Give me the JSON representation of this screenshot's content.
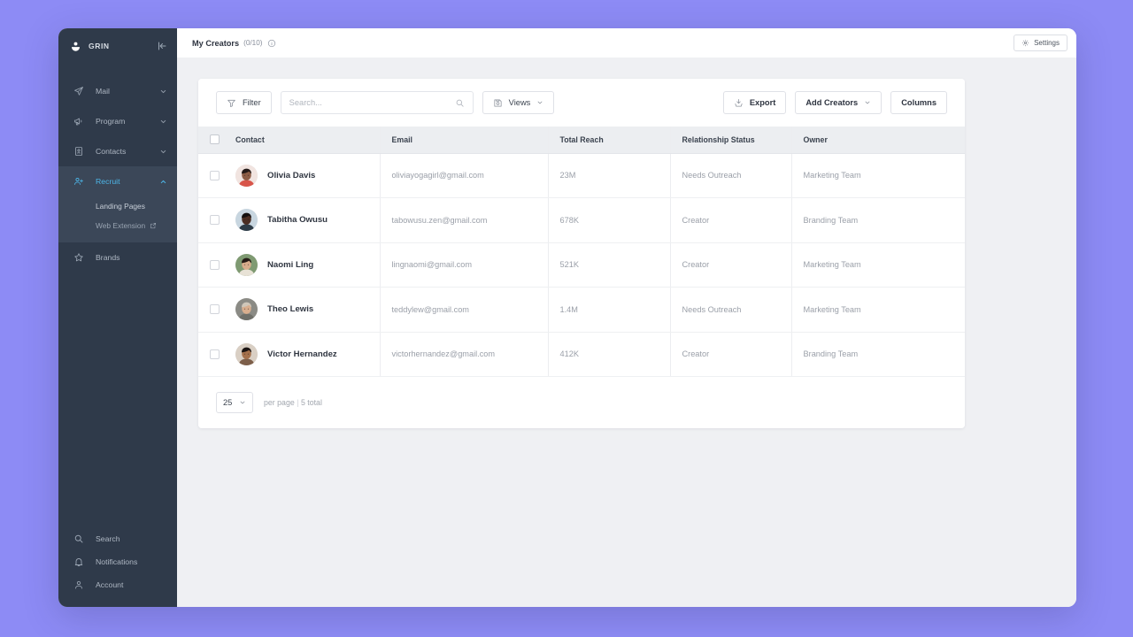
{
  "theme": {
    "desktop_bg": "#8d8bf5",
    "sidebar_bg": "#2f3a4a",
    "sidebar_active_bg": "#3b4758",
    "accent": "#4db6e8",
    "content_bg": "#eff0f3",
    "card_bg": "#ffffff",
    "table_header_bg": "#eceef1"
  },
  "sidebar": {
    "brand": {
      "name": "GRIN",
      "logo_icon": "grin-logo-icon",
      "collapse_icon": "collapse-panel-icon"
    },
    "items": [
      {
        "label": "Mail",
        "icon": "paper-plane-icon",
        "chevron": "chevron-down-icon",
        "active": false
      },
      {
        "label": "Program",
        "icon": "megaphone-icon",
        "chevron": "chevron-down-icon",
        "active": false
      },
      {
        "label": "Contacts",
        "icon": "contact-card-icon",
        "chevron": "chevron-down-icon",
        "active": false
      },
      {
        "label": "Recruit",
        "icon": "user-plus-icon",
        "chevron": "chevron-up-icon",
        "active": true
      },
      {
        "label": "Brands",
        "icon": "star-icon",
        "chevron": "",
        "active": false
      }
    ],
    "recruit_subitems": [
      {
        "label": "Landing Pages",
        "external": false
      },
      {
        "label": "Web Extension",
        "external": true,
        "icon": "external-link-icon"
      }
    ],
    "bottom_items": [
      {
        "label": "Search",
        "icon": "search-icon"
      },
      {
        "label": "Notifications",
        "icon": "bell-icon"
      },
      {
        "label": "Account",
        "icon": "user-icon"
      }
    ]
  },
  "topbar": {
    "title": "My Creators",
    "count": "(0/10)",
    "info_icon": "info-circle-icon",
    "settings_label": "Settings",
    "settings_icon": "gear-icon"
  },
  "toolbar": {
    "filter_label": "Filter",
    "filter_icon": "funnel-icon",
    "search_placeholder": "Search...",
    "search_value": "",
    "search_icon": "search-icon",
    "views_label": "Views",
    "views_icon": "save-disk-icon",
    "views_chevron": "chevron-down-icon",
    "export_label": "Export",
    "export_icon": "export-download-icon",
    "add_creators_label": "Add Creators",
    "add_creators_chevron": "chevron-down-icon",
    "columns_label": "Columns"
  },
  "table": {
    "columns": [
      "Contact",
      "Email",
      "Total Reach",
      "Relationship Status",
      "Owner"
    ],
    "select_all_checked": false,
    "rows": [
      {
        "checked": false,
        "name": "Olivia Davis",
        "email": "oliviayogagirl@gmail.com",
        "total_reach": "23M",
        "relationship_status": "Needs Outreach",
        "owner": "Marketing Team",
        "avatar_bg": "#f1e4e0",
        "avatar_skin": "#8d5d46",
        "avatar_hair": "#241a18",
        "avatar_shirt": "#d8554a"
      },
      {
        "checked": false,
        "name": "Tabitha Owusu",
        "email": "tabowusu.zen@gmail.com",
        "total_reach": "678K",
        "relationship_status": "Creator",
        "owner": "Branding Team",
        "avatar_bg": "#c8d6e0",
        "avatar_skin": "#4b2e23",
        "avatar_hair": "#151010",
        "avatar_shirt": "#2d3b46"
      },
      {
        "checked": false,
        "name": "Naomi Ling",
        "email": "lingnaomi@gmail.com",
        "total_reach": "521K",
        "relationship_status": "Creator",
        "owner": "Marketing Team",
        "avatar_bg": "#7f9a72",
        "avatar_skin": "#d8ad8c",
        "avatar_hair": "#251b16",
        "avatar_shirt": "#e8e2d6"
      },
      {
        "checked": false,
        "name": "Theo Lewis",
        "email": "teddylew@gmail.com",
        "total_reach": "1.4M",
        "relationship_status": "Needs Outreach",
        "owner": "Marketing Team",
        "avatar_bg": "#8b8b85",
        "avatar_skin": "#d9ae8e",
        "avatar_hair": "#cfc7ba",
        "avatar_shirt": "#6f6f69"
      },
      {
        "checked": false,
        "name": "Victor Hernandez",
        "email": "victorhernandez@gmail.com",
        "total_reach": "412K",
        "relationship_status": "Creator",
        "owner": "Branding Team",
        "avatar_bg": "#d9cfc4",
        "avatar_skin": "#a5714c",
        "avatar_hair": "#1b1412",
        "avatar_shirt": "#7d5f4a"
      }
    ]
  },
  "footer": {
    "per_page_value": "25",
    "per_page_chevron": "chevron-down-icon",
    "per_page_label": "per page",
    "separator": "|",
    "total_label": "5 total"
  }
}
